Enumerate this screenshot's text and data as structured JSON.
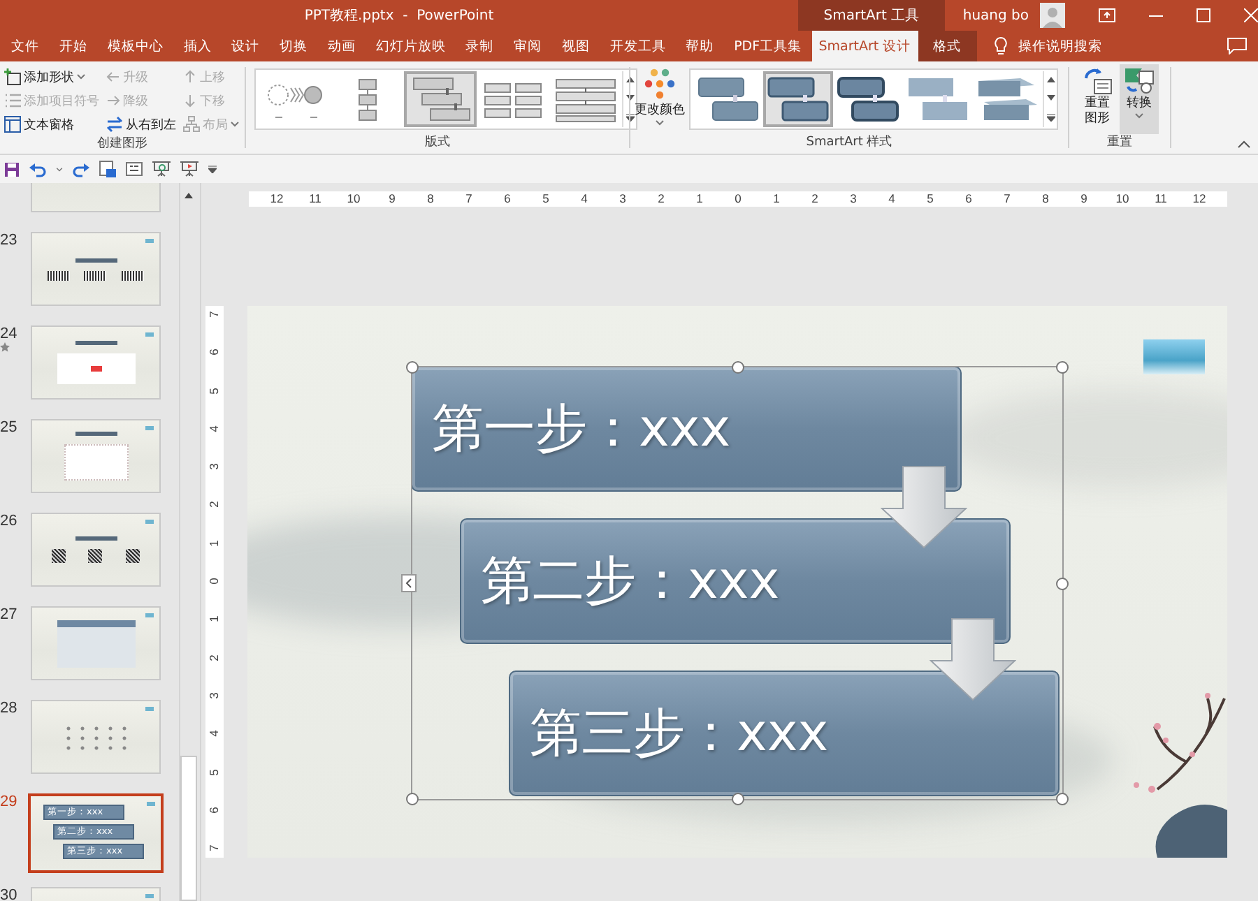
{
  "window": {
    "title": "PPT教程.pptx  -  PowerPoint",
    "context_label": "SmartArt 工具",
    "user": "huang bo"
  },
  "tabs": [
    {
      "label": "文件",
      "selected": false,
      "contextual": false
    },
    {
      "label": "开始",
      "selected": false,
      "contextual": false
    },
    {
      "label": "模板中心",
      "selected": false,
      "contextual": false
    },
    {
      "label": "插入",
      "selected": false,
      "contextual": false
    },
    {
      "label": "设计",
      "selected": false,
      "contextual": false
    },
    {
      "label": "切换",
      "selected": false,
      "contextual": false
    },
    {
      "label": "动画",
      "selected": false,
      "contextual": false
    },
    {
      "label": "幻灯片放映",
      "selected": false,
      "contextual": false
    },
    {
      "label": "录制",
      "selected": false,
      "contextual": false
    },
    {
      "label": "审阅",
      "selected": false,
      "contextual": false
    },
    {
      "label": "视图",
      "selected": false,
      "contextual": false
    },
    {
      "label": "开发工具",
      "selected": false,
      "contextual": false
    },
    {
      "label": "帮助",
      "selected": false,
      "contextual": false
    },
    {
      "label": "PDF工具集",
      "selected": false,
      "contextual": false
    },
    {
      "label": "SmartArt 设计",
      "selected": true,
      "contextual": true
    },
    {
      "label": "格式",
      "selected": false,
      "contextual": true
    }
  ],
  "tell_me": "操作说明搜索",
  "ribbon": {
    "create_group": {
      "label": "创建图形",
      "columns": [
        [
          {
            "label": "添加形状",
            "kind": "add-shape",
            "disabled": false,
            "dropdown": true
          },
          {
            "label": "添加项目符号",
            "kind": "bullet",
            "disabled": true,
            "dropdown": false
          },
          {
            "label": "文本窗格",
            "kind": "text-pane",
            "disabled": false,
            "dropdown": false
          }
        ],
        [
          {
            "label": "升级",
            "kind": "left",
            "disabled": true,
            "dropdown": false
          },
          {
            "label": "降级",
            "kind": "right",
            "disabled": true,
            "dropdown": false
          },
          {
            "label": "从右到左",
            "kind": "swap",
            "disabled": false,
            "dropdown": false
          }
        ],
        [
          {
            "label": "上移",
            "kind": "up",
            "disabled": true,
            "dropdown": false
          },
          {
            "label": "下移",
            "kind": "down",
            "disabled": true,
            "dropdown": false
          },
          {
            "label": "布局",
            "kind": "layout",
            "disabled": true,
            "dropdown": true
          }
        ]
      ]
    },
    "layouts_group": {
      "label": "版式",
      "items": [
        {
          "kind": "circles",
          "selected": false
        },
        {
          "kind": "vertical",
          "selected": false
        },
        {
          "kind": "staircase",
          "selected": true
        },
        {
          "kind": "grid",
          "selected": false
        },
        {
          "kind": "rows",
          "selected": false
        }
      ]
    },
    "styles_group": {
      "label": "SmartArt 样式",
      "change_colors": "更改颜色",
      "items": [
        {
          "kind": "flat",
          "selected": false
        },
        {
          "kind": "raised",
          "selected": true
        },
        {
          "kind": "outlined",
          "selected": false
        },
        {
          "kind": "light",
          "selected": false
        },
        {
          "kind": "isometric",
          "selected": false
        }
      ]
    },
    "reset_group": {
      "label": "重置",
      "buttons": [
        {
          "label": "重置图形",
          "kind": "reset",
          "selected": false,
          "dropdown": false
        },
        {
          "label": "转换",
          "kind": "convert",
          "selected": true,
          "dropdown": true
        }
      ]
    }
  },
  "rulers": {
    "horizontal": [
      "12",
      "11",
      "10",
      "9",
      "8",
      "7",
      "6",
      "5",
      "4",
      "3",
      "2",
      "1",
      "0",
      "1",
      "2",
      "3",
      "4",
      "5",
      "6",
      "7",
      "8",
      "9",
      "10",
      "11",
      "12"
    ],
    "vertical": [
      "7",
      "6",
      "5",
      "4",
      "3",
      "2",
      "1",
      "0",
      "1",
      "2",
      "3",
      "4",
      "5",
      "6",
      "7"
    ]
  },
  "slides": [
    {
      "kind": "blank",
      "selected": false,
      "starred": false
    },
    {
      "number": "23",
      "kind": "barcodes",
      "selected": false,
      "starred": false
    },
    {
      "number": "24",
      "kind": "mindmap",
      "selected": false,
      "starred": true
    },
    {
      "number": "25",
      "kind": "flowchart",
      "selected": false,
      "starred": false
    },
    {
      "number": "26",
      "kind": "qrcodes",
      "selected": false,
      "starred": false
    },
    {
      "number": "27",
      "kind": "table",
      "selected": false,
      "starred": false
    },
    {
      "number": "28",
      "kind": "scatter",
      "selected": false,
      "starred": false
    },
    {
      "number": "29",
      "kind": "steps",
      "selected": true,
      "starred": false,
      "steps": [
        "第一步：xxx",
        "第二步：xxx",
        "第三步：xxx"
      ]
    },
    {
      "number": "30",
      "kind": "blank",
      "selected": false,
      "starred": false
    }
  ],
  "slide": {
    "steps": [
      "第一步：xxx",
      "第二步：xxx",
      "第三步：xxx"
    ]
  }
}
